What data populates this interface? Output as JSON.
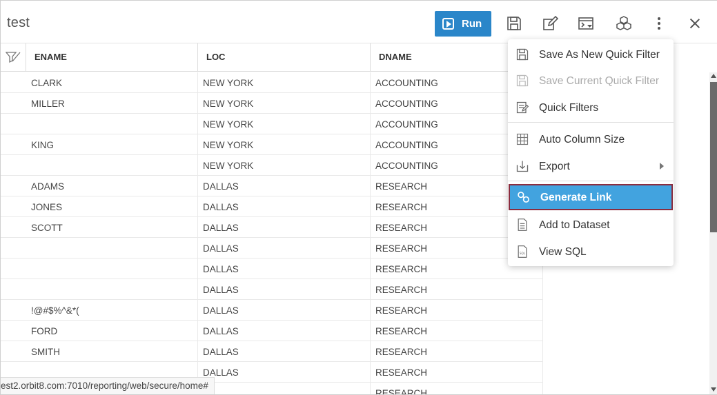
{
  "header": {
    "title": "test",
    "run_label": "Run",
    "tools": [
      "save-icon",
      "edit-icon",
      "console-icon",
      "cubes-icon"
    ]
  },
  "grid": {
    "columns": [
      "ENAME",
      "LOC",
      "DNAME"
    ],
    "rows": [
      [
        "CLARK",
        "NEW YORK",
        "ACCOUNTING"
      ],
      [
        "MILLER",
        "NEW YORK",
        "ACCOUNTING"
      ],
      [
        "",
        "NEW YORK",
        "ACCOUNTING"
      ],
      [
        "KING",
        "NEW YORK",
        "ACCOUNTING"
      ],
      [
        "",
        "NEW YORK",
        "ACCOUNTING"
      ],
      [
        "ADAMS",
        "DALLAS",
        "RESEARCH"
      ],
      [
        "JONES",
        "DALLAS",
        "RESEARCH"
      ],
      [
        "SCOTT",
        "DALLAS",
        "RESEARCH"
      ],
      [
        "",
        "DALLAS",
        "RESEARCH"
      ],
      [
        "",
        "DALLAS",
        "RESEARCH"
      ],
      [
        "",
        "DALLAS",
        "RESEARCH"
      ],
      [
        "!@#$%^&*(",
        "DALLAS",
        "RESEARCH"
      ],
      [
        "FORD",
        "DALLAS",
        "RESEARCH"
      ],
      [
        "SMITH",
        "DALLAS",
        "RESEARCH"
      ],
      [
        "",
        "DALLAS",
        "RESEARCH"
      ],
      [
        "",
        "",
        "RESEARCH"
      ]
    ]
  },
  "menu": {
    "items": [
      {
        "label": "Save As New Quick Filter",
        "icon": "save-icon",
        "disabled": false
      },
      {
        "label": "Save Current Quick Filter",
        "icon": "save-icon",
        "disabled": true
      },
      {
        "label": "Quick Filters",
        "icon": "filter-list-icon",
        "disabled": false
      },
      {
        "label": "Auto Column Size",
        "icon": "grid-icon",
        "disabled": false
      },
      {
        "label": "Export",
        "icon": "export-icon",
        "disabled": false
      },
      {
        "label": "Generate Link",
        "icon": "link-icon",
        "disabled": false,
        "active": true
      },
      {
        "label": "Add to Dataset",
        "icon": "document-icon",
        "disabled": false
      },
      {
        "label": "View SQL",
        "icon": "sql-file-icon",
        "disabled": false
      }
    ]
  },
  "status": {
    "url": "est2.orbit8.com:7010/reporting/web/secure/home#"
  },
  "colors": {
    "run_button": "#2a86c9",
    "menu_active": "#42a3df",
    "menu_active_border": "#8b2d3f"
  }
}
